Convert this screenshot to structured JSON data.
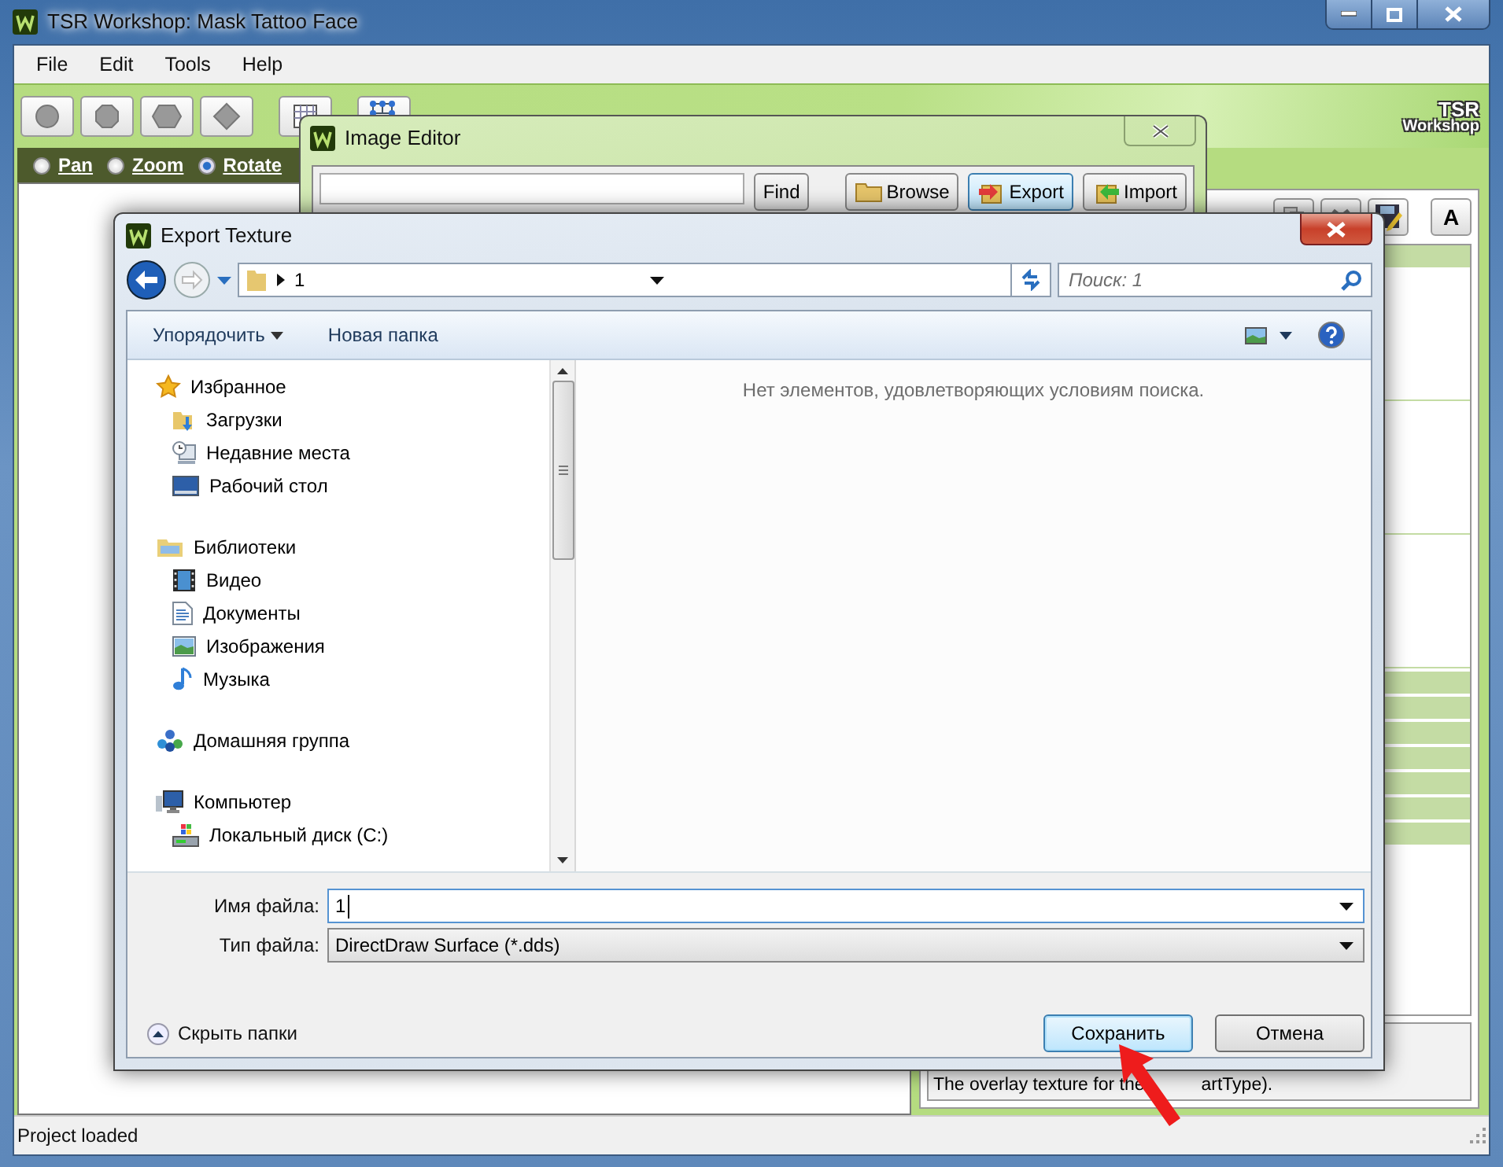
{
  "window": {
    "title": "TSR Workshop: Mask Tattoo Face"
  },
  "menu": [
    "File",
    "Edit",
    "Tools",
    "Help"
  ],
  "logo": {
    "line1": "TSR",
    "line2": "Workshop"
  },
  "view_modes": [
    {
      "label": "Pan",
      "selected": false
    },
    {
      "label": "Zoom",
      "selected": false
    },
    {
      "label": "Rotate",
      "selected": true
    }
  ],
  "properties": {
    "font_button": "A",
    "description_parts": [
      "The overlay texture for the",
      "artType)."
    ]
  },
  "status_bar": "Project loaded",
  "image_editor": {
    "title": "Image Editor",
    "buttons": [
      {
        "label": "Find",
        "kind": "plain",
        "focused": false
      },
      {
        "label": "Browse",
        "kind": "folder",
        "focused": false
      },
      {
        "label": "Export",
        "kind": "export",
        "focused": true
      },
      {
        "label": "Import",
        "kind": "import",
        "focused": false
      }
    ]
  },
  "export_dialog": {
    "title": "Export Texture",
    "path": [
      "1"
    ],
    "search": {
      "placeholder": "Поиск: 1"
    },
    "commands": [
      {
        "label": "Упорядочить",
        "dropdown": true
      },
      {
        "label": "Новая папка",
        "dropdown": false
      }
    ],
    "nav": [
      {
        "label": "Избранное",
        "kind": "favorites",
        "children": [
          {
            "label": "Загрузки",
            "kind": "downloads"
          },
          {
            "label": "Недавние места",
            "kind": "recent"
          },
          {
            "label": "Рабочий стол",
            "kind": "desktop"
          }
        ]
      },
      {
        "label": "Библиотеки",
        "kind": "libraries",
        "children": [
          {
            "label": "Видео",
            "kind": "video"
          },
          {
            "label": "Документы",
            "kind": "documents"
          },
          {
            "label": "Изображения",
            "kind": "pictures"
          },
          {
            "label": "Музыка",
            "kind": "music"
          }
        ]
      },
      {
        "label": "Домашняя группа",
        "kind": "homegroup"
      },
      {
        "label": "Компьютер",
        "kind": "computer",
        "children": [
          {
            "label": "Локальный диск (C:)",
            "kind": "disk"
          }
        ]
      }
    ],
    "empty_message": "Нет элементов, удовлетворяющих условиям поиска.",
    "fields": [
      {
        "label": "Имя файла:",
        "value": "1",
        "kind": "edit"
      },
      {
        "label": "Тип файла:",
        "value": "DirectDraw Surface (*.dds)",
        "kind": "list"
      }
    ],
    "hide_folders": "Скрыть папки",
    "buttons": [
      {
        "label": "Сохранить",
        "default": true
      },
      {
        "label": "Отмена",
        "default": false
      }
    ]
  }
}
